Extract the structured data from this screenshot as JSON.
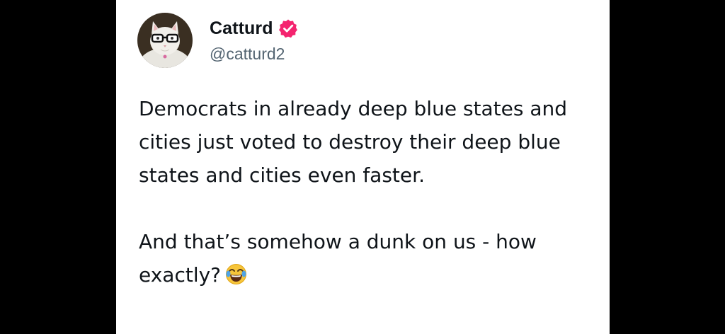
{
  "author": {
    "display_name": "Catturd",
    "handle": "@catturd2",
    "avatar_icon": "cat-with-glasses-avatar",
    "verified_icon": "verified-badge-icon",
    "verified_color": "#f4246f"
  },
  "tweet": {
    "paragraph_1": "Democrats in already deep blue states and cities just voted to destroy their deep blue states and cities even faster.",
    "paragraph_2": "And that’s somehow a dunk on us - how exactly?",
    "emoji_icon": "face-with-tears-of-joy-emoji"
  },
  "colors": {
    "background": "#000000",
    "card": "#ffffff",
    "text": "#0f1419",
    "secondary_text": "#536471"
  }
}
